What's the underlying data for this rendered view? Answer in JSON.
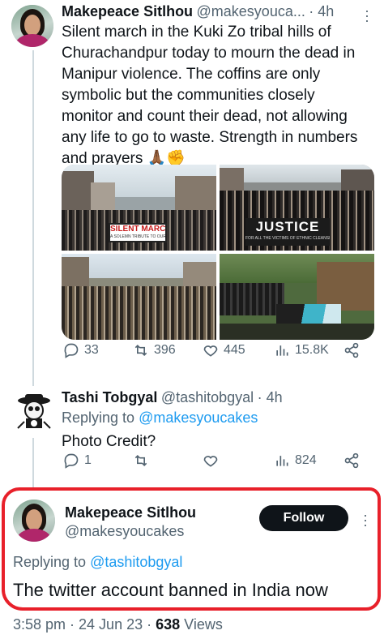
{
  "tweet1": {
    "author_name": "Makepeace Sitlhou",
    "author_handle": "@makesyouca...",
    "time": "4h",
    "text_lines": [
      "Silent march in the Kuki Zo tribal hills of",
      "Churachandpur today to mourn the dead in",
      "Manipur violence. The coffins are only",
      "symbolic but the communities closely",
      "monitor and count their dead, not allowing",
      "any life to go to waste. Strength in numbers",
      "and prayers 🙏🏾✊"
    ],
    "media": {
      "banner1_text": "SILENT MARCH",
      "banner1_sub": "A SOLEMN TRIBUTE TO OUR DEPARTED SOULS",
      "banner2_text": "JUSTICE",
      "banner2_sub": "FOR ALL THE VICTIMS OF ETHNIC CLEANSING"
    },
    "actions": {
      "replies": "33",
      "retweets": "396",
      "likes": "445",
      "views": "15.8K"
    }
  },
  "tweet2": {
    "author_name": "Tashi Tobgyal",
    "author_handle": "@tashitobgyal",
    "time": "4h",
    "replying_prefix": "Replying to",
    "replying_handle": "@makesyoucakes",
    "text": "Photo Credit?",
    "actions": {
      "replies": "1",
      "views": "824"
    }
  },
  "tweet3": {
    "author_name": "Makepeace Sitlhou",
    "author_handle": "@makesyoucakes",
    "follow_label": "Follow",
    "replying_prefix": "Replying to",
    "replying_handle": "@tashitobgyal",
    "text": "The twitter account banned in India now",
    "timestamp": "3:58 pm · 24 Jun 23 · ",
    "views_count": "638",
    "views_label": " Views"
  },
  "colors": {
    "accent": "#1d9bf0",
    "muted": "#536471",
    "highlight": "#e8202a",
    "follow_bg": "#0f1419"
  }
}
